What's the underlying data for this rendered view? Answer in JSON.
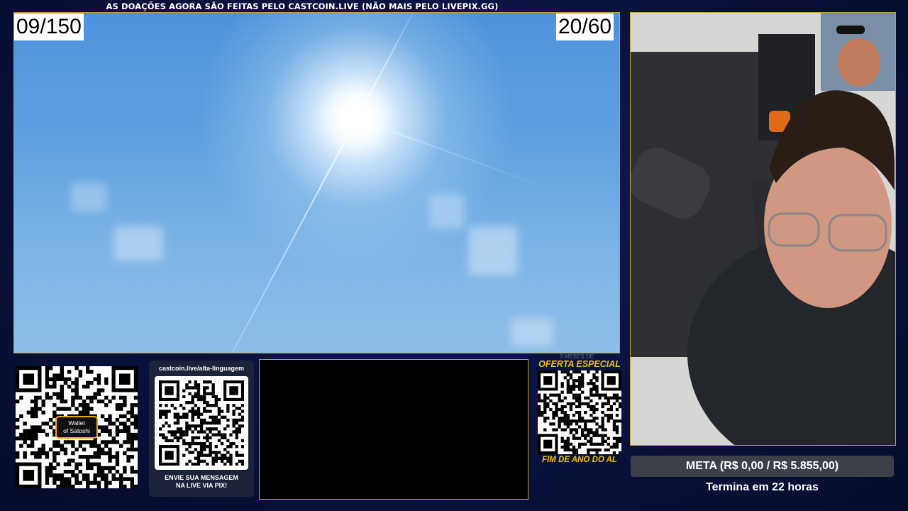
{
  "ticker": {
    "text": "AS DOAÇÕES AGORA SÃO FEITAS PELO CASTCOIN.LIVE (NÃO MAIS PELO LIVEPIX.GG)"
  },
  "counters": {
    "left": "09/150",
    "right": "20/60"
  },
  "qr_wallet": {
    "badge_line1": "Wallet",
    "badge_line2": "of Satoshi"
  },
  "pix_panel": {
    "url": "castcoin.live/alta-linguagem",
    "message_line1": "ENVIE SUA MENSAGEM",
    "message_line2": "NA LIVE VIA PIX!"
  },
  "offer": {
    "faint_text": "3 MESES DE",
    "title": "OFERTA ESPECIAL",
    "subtitle": "FIM DE ANO DO AL"
  },
  "goal": {
    "label": "META (R$ 0,00 / R$ 5.855,00)",
    "time": "Termina em 22 horas"
  },
  "colors": {
    "accent_border": "#c9a227",
    "offer_yellow": "#f5c000",
    "background": "#09123e",
    "goal_bar": "#3d4048"
  }
}
